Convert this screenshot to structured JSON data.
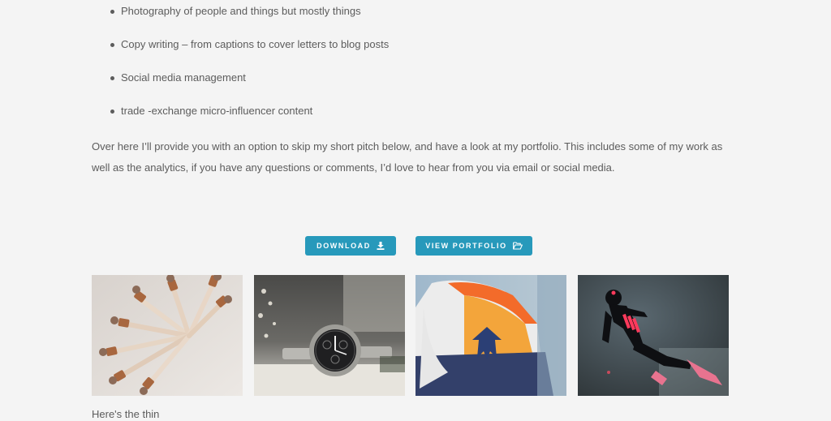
{
  "services": [
    "Photography of people and things but mostly things",
    "Copy writing  – from captions to cover letters to blog posts",
    "Social media management",
    "trade -exchange micro-influencer content"
  ],
  "intro_paragraph": "Over here I’ll provide you with an option to skip my short pitch below, and have a look at my portfolio. This includes some of my work as well as the analytics, if you have any questions or comments, I’d love to hear from you via email or social media.",
  "buttons": {
    "download_label": "DOWNLOAD",
    "download_icon": "download-icon",
    "portfolio_label": "VIEW PORTFOLIO",
    "portfolio_icon": "folder-open-icon"
  },
  "gallery": [
    {
      "subject": "cosmetic dropper bottles"
    },
    {
      "subject": "silver wristwatch"
    },
    {
      "subject": "sneaker close-up"
    },
    {
      "subject": "diver with lights underwater"
    }
  ],
  "next_text": "Here's the thin",
  "colors": {
    "accent": "#2799bb",
    "background": "#f4f4f4",
    "text": "#5c5c5c"
  }
}
